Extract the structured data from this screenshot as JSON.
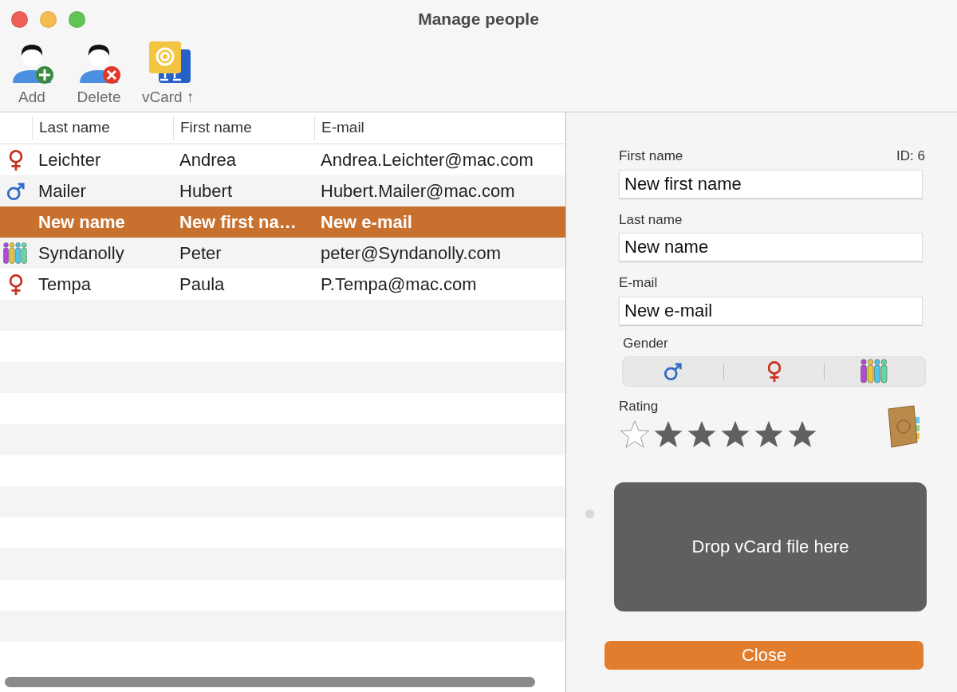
{
  "window": {
    "title": "Manage people"
  },
  "toolbar": [
    {
      "kind": "add",
      "label": "Add"
    },
    {
      "kind": "delete",
      "label": "Delete"
    },
    {
      "kind": "vcard",
      "label": "vCard ↑"
    }
  ],
  "table": {
    "columns": [
      "Last name",
      "First name",
      "E-mail"
    ],
    "rows": [
      {
        "kind": "female",
        "selected": false,
        "cells": [
          "Leichter",
          "Andrea",
          "Andrea.Leichter@mac.com"
        ]
      },
      {
        "kind": "male",
        "selected": false,
        "cells": [
          "Mailer",
          "Hubert",
          "Hubert.Mailer@mac.com"
        ]
      },
      {
        "kind": "blank",
        "selected": true,
        "cells": [
          "New name",
          "New first na…",
          "New e-mail"
        ]
      },
      {
        "kind": "diverse",
        "selected": false,
        "cells": [
          "Syndanolly",
          "Peter",
          "peter@Syndanolly.com"
        ]
      },
      {
        "kind": "female",
        "selected": false,
        "cells": [
          "Tempa",
          "Paula",
          "P.Tempa@mac.com"
        ]
      }
    ]
  },
  "detail": {
    "id": "ID: 6",
    "fields": [
      {
        "label": "First name",
        "value": "New first name"
      },
      {
        "label": "Last name",
        "value": "New name"
      },
      {
        "label": "E-mail",
        "value": "New e-mail"
      }
    ],
    "gender": {
      "label": "Gender",
      "options": [
        {
          "kind": "male",
          "selected": false
        },
        {
          "kind": "female",
          "selected": false
        },
        {
          "kind": "diverse",
          "selected": false
        }
      ]
    },
    "rating": {
      "label": "Rating",
      "stars": 5
    },
    "drop_zone": "Drop vCard file here",
    "close_button": "Close"
  }
}
